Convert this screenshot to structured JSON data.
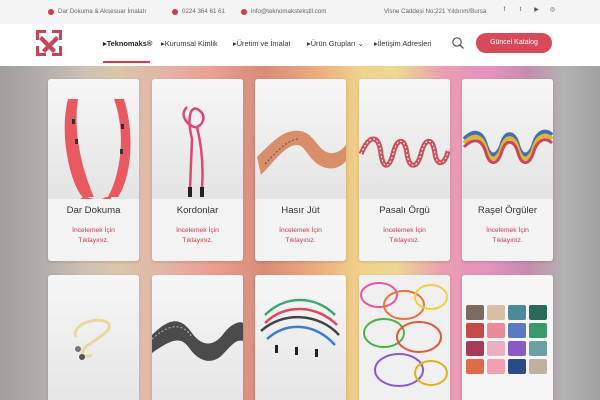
{
  "topbar": {
    "tagline": "Dar Dokuma & Aksesuar İmalatı",
    "phone": "0224 364 61 61",
    "email": "info@teknomakstekstil.com",
    "address": "Visne Caddesi No:221 Yıldırım/Bursa",
    "social": [
      "facebook-icon",
      "twitter-icon",
      "youtube-icon",
      "instagram-icon"
    ]
  },
  "nav": {
    "items": [
      {
        "label": "▸Teknomaks®"
      },
      {
        "label": "▸Kurumsal Kimlik"
      },
      {
        "label": "▸Üretim ve İmalat"
      },
      {
        "label": "▸Ürün Grupları"
      },
      {
        "label": "▸İletişim Adresleri"
      }
    ],
    "dropdown_chevron": "⌄",
    "catalog_button": "Güncel Katalog"
  },
  "colors": {
    "accent": "#d23b4e"
  },
  "cards": [
    {
      "title": "Dar Dokuma",
      "cta": "İncelemek İçin Tıklayınız."
    },
    {
      "title": "Kordonlar",
      "cta": "İncelemek İçin Tıklayınız."
    },
    {
      "title": "Hasır Jüt",
      "cta": "İncelemek İçin Tıklayınız."
    },
    {
      "title": "Pasalı Örgü",
      "cta": "İncelemek İçin Tıklayınız."
    },
    {
      "title": "Raşel Örgüler",
      "cta": "İncelemek İçin Tıklayınız."
    }
  ],
  "cards_row2": [
    "elastic-cord-photo",
    "woven-tape-photo",
    "drawcord-photo",
    "round-elastic-photo",
    "webbing-rolls-photo"
  ]
}
